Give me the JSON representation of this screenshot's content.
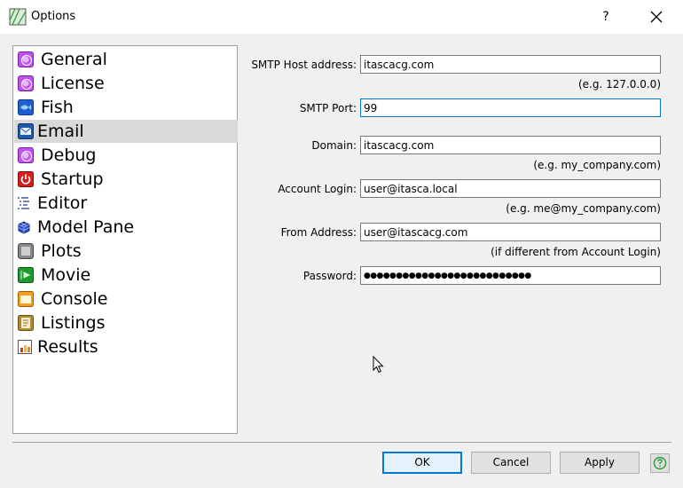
{
  "window": {
    "title": "Options",
    "help_glyph": "?"
  },
  "nav": {
    "items": [
      {
        "label": "General",
        "icon": "globe-icon"
      },
      {
        "label": "License",
        "icon": "globe-icon"
      },
      {
        "label": "Fish",
        "icon": "fish-icon"
      },
      {
        "label": "Email",
        "icon": "email-icon",
        "selected": true
      },
      {
        "label": "Debug",
        "icon": "globe-icon"
      },
      {
        "label": "Startup",
        "icon": "power-icon"
      },
      {
        "label": "Editor",
        "icon": "editor-lines-icon"
      },
      {
        "label": "Model Pane",
        "icon": "cube-icon"
      },
      {
        "label": "Plots",
        "icon": "plots-icon"
      },
      {
        "label": "Movie",
        "icon": "movie-icon"
      },
      {
        "label": "Console",
        "icon": "console-icon"
      },
      {
        "label": "Listings",
        "icon": "listings-icon"
      },
      {
        "label": "Results",
        "icon": "results-chart-icon"
      }
    ]
  },
  "form": {
    "smtp_host": {
      "label": "SMTP Host address:",
      "value": "itascacg.com",
      "hint": "(e.g. 127.0.0.0)"
    },
    "smtp_port": {
      "label": "SMTP Port:",
      "value": "99"
    },
    "domain": {
      "label": "Domain:",
      "value": "itascacg.com",
      "hint": "(e.g. my_company.com)"
    },
    "account_login": {
      "label": "Account Login:",
      "value": "user@itasca.local",
      "hint": "(e.g. me@my_company.com)"
    },
    "from_address": {
      "label": "From Address:",
      "value": "user@itascacg.com",
      "hint": "(if different from Account Login)"
    },
    "password": {
      "label": "Password:",
      "value": "●●●●●●●●●●●●●●●●●●●●●●●●●●"
    }
  },
  "buttons": {
    "ok": "OK",
    "cancel": "Cancel",
    "apply": "Apply"
  },
  "colors": {
    "accent": "#0078d7",
    "selection": "#d9d9d9",
    "help_green": "#2e9d3a"
  }
}
